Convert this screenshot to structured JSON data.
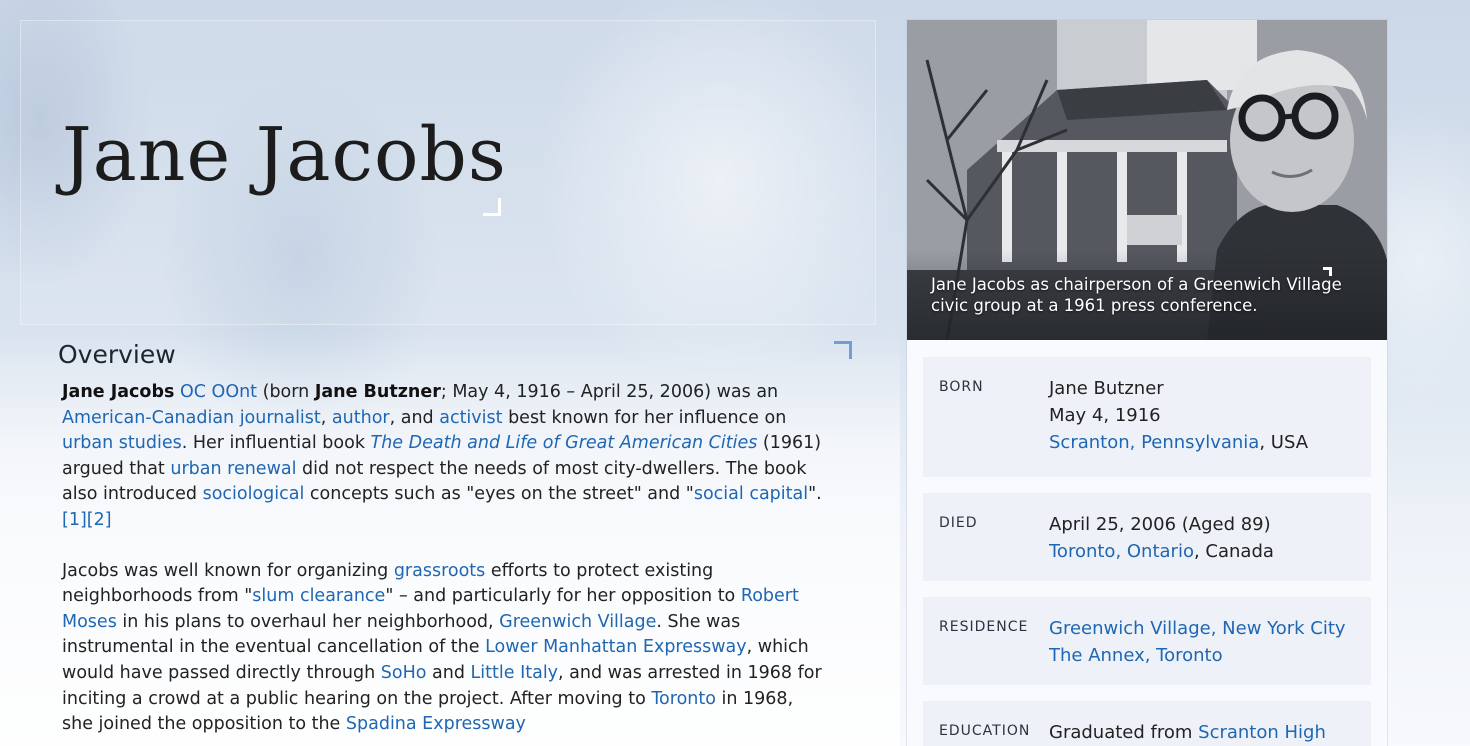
{
  "page": {
    "title": "Jane Jacobs"
  },
  "overview": {
    "heading": "Overview",
    "p1": {
      "name": "Jane Jacobs",
      "honors": "OC OOnt",
      "born_prefix": "(born ",
      "birth_name": "Jane Butzner",
      "dates": "; May 4, 1916 – April 25, 2006) was an ",
      "link_nationality": "American-Canadian journalist",
      "sep1": ", ",
      "link_author": "author",
      "sep2": ", and ",
      "link_activist": "activist",
      "t1": " best known for her influence on ",
      "link_urban_studies": "urban studies",
      "t2": ". Her influential book ",
      "link_book": "The Death and Life of Great American Cities",
      "t3": " (1961) argued that ",
      "link_urban_renewal": "urban renewal",
      "t4": " did not respect the needs of most city-dwellers. The book also introduced ",
      "link_sociological": "sociological",
      "t5": " concepts such as \"eyes on the street\" and \"",
      "link_social_capital": "social capital",
      "t6": "\".",
      "ref1": "[1]",
      "ref2": "[2]"
    },
    "p2": {
      "t1": "Jacobs was well known for organizing ",
      "link_grassroots": "grassroots",
      "t2": " efforts to protect existing neighborhoods from \"",
      "link_slum": "slum clearance",
      "t3": "\" – and particularly for her opposition to ",
      "link_moses": "Robert Moses",
      "t4": " in his plans to overhaul her neighborhood, ",
      "link_gv": "Greenwich Village",
      "t5": ". She was instrumental in the eventual cancellation of the ",
      "link_lme": "Lower Manhattan Expressway",
      "t6": ", which would have passed directly through ",
      "link_soho": "SoHo",
      "t7": " and ",
      "link_little_italy": "Little Italy",
      "t8": ", and was arrested in 1968 for inciting a crowd at a public hearing on the project. After moving to ",
      "link_toronto": "Toronto",
      "t9": " in 1968, she joined the opposition to the ",
      "link_spadina": "Spadina Expressway"
    }
  },
  "infobox": {
    "caption": "Jane Jacobs as chairperson of a Greenwich Village civic group at a 1961 press conference.",
    "born": {
      "label": "BORN",
      "line1": "Jane Butzner",
      "line2": "May 4, 1916",
      "place_link": "Scranton, Pennsylvania",
      "place_suffix": ", USA"
    },
    "died": {
      "label": "DIED",
      "line1": "April 25, 2006 (Aged 89)",
      "place_link": "Toronto, Ontario",
      "place_suffix": ", Canada"
    },
    "residence": {
      "label": "RESIDENCE",
      "link1": "Greenwich Village, New York City",
      "link2": "The Annex, Toronto"
    },
    "education": {
      "label": "EDUCATION",
      "prefix": "Graduated from ",
      "link": "Scranton High"
    }
  },
  "colors": {
    "link": "#1f66b3",
    "accent_corner": "#6f9fd4"
  }
}
